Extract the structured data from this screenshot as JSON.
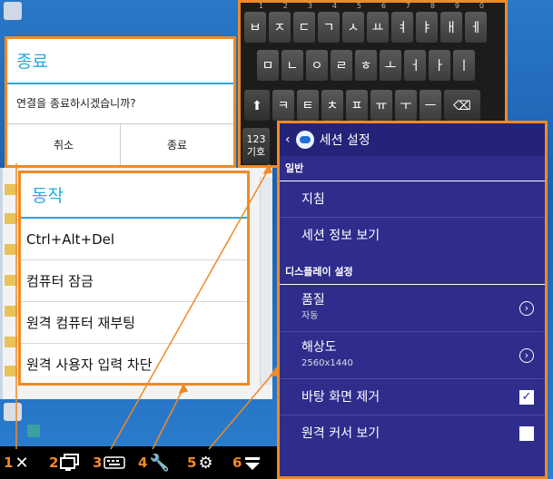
{
  "exit_dialog": {
    "title": "종료",
    "message": "연결을 종료하시겠습니까?",
    "cancel_label": "취소",
    "confirm_label": "종료"
  },
  "action_dialog": {
    "title": "동작",
    "items": [
      "Ctrl+Alt+Del",
      "컴퓨터 잠금",
      "원격 컴퓨터 재부팅",
      "원격 사용자 입력 차단"
    ]
  },
  "keyboard": {
    "row1": [
      {
        "key": "ㅂ",
        "num": "1"
      },
      {
        "key": "ㅈ",
        "num": "2"
      },
      {
        "key": "ㄷ",
        "num": "3"
      },
      {
        "key": "ㄱ",
        "num": "4"
      },
      {
        "key": "ㅅ",
        "num": "5"
      },
      {
        "key": "ㅛ",
        "num": "6"
      },
      {
        "key": "ㅕ",
        "num": "7"
      },
      {
        "key": "ㅑ",
        "num": "8"
      },
      {
        "key": "ㅐ",
        "num": "9"
      },
      {
        "key": "ㅔ",
        "num": "0"
      }
    ],
    "row2": [
      "ㅁ",
      "ㄴ",
      "ㅇ",
      "ㄹ",
      "ㅎ",
      "ㅗ",
      "ㅓ",
      "ㅏ",
      "ㅣ"
    ],
    "row3": [
      "ㅋ",
      "ㅌ",
      "ㅊ",
      "ㅍ",
      "ㅠ",
      "ㅜ",
      "ㅡ"
    ],
    "symbol_key": "123\n기호",
    "symbol_key_line1": "123",
    "symbol_key_line2": "기호"
  },
  "settings": {
    "header": "세션 설정",
    "section_general": "일반",
    "guide": "지침",
    "session_info": "세션 정보 보기",
    "section_display": "디스플레이 설정",
    "quality_label": "품질",
    "quality_value": "자동",
    "resolution_label": "해상도",
    "resolution_value": "2560x1440",
    "remove_wallpaper": "바탕 화면 제거",
    "remove_wallpaper_checked": true,
    "show_remote_cursor": "원격 커서 보기",
    "show_remote_cursor_checked": false
  },
  "toolbar": {
    "items": [
      {
        "num": "1",
        "icon": "close-icon"
      },
      {
        "num": "2",
        "icon": "monitor-icon"
      },
      {
        "num": "3",
        "icon": "keyboard-icon"
      },
      {
        "num": "4",
        "icon": "wrench-icon"
      },
      {
        "num": "5",
        "icon": "gear-icon"
      },
      {
        "num": "6",
        "icon": "menu-down-icon"
      }
    ]
  },
  "colors": {
    "accent_orange": "#f08a24",
    "dialog_title_blue": "#2aa7e0",
    "settings_bg": "#2e2d8c"
  }
}
